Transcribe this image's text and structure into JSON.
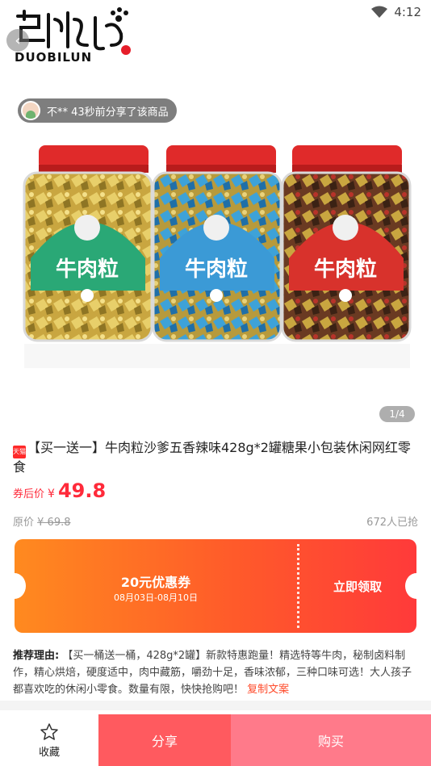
{
  "status_bar": {
    "time": "4:12",
    "wifi_icon": "wifi-icon"
  },
  "brand": {
    "logo_text": "DUOBILUN"
  },
  "share_notice": {
    "text": "不** 43秒前分享了该商品"
  },
  "gallery": {
    "indicator": "1/4",
    "product_label": "牛肉粒"
  },
  "product": {
    "badge": "天猫",
    "title": "【买一送一】牛肉粒沙爹五香辣味428g*2罐糖果小包装休闲网红零食",
    "price_label": "券后价",
    "price_symbol": "¥",
    "price": "49.8",
    "original_label": "原价",
    "original_price": "¥ 69.8",
    "sold_count": "672人已抢"
  },
  "coupon": {
    "amount": "20元优惠券",
    "dates": "08月03日-08月10日",
    "claim_label": "立即领取"
  },
  "recommendation": {
    "label": "推荐理由:",
    "text": "【买一桶送一桶，428g*2罐】新款特惠跑量！精选特等牛肉，秘制卤料制作，精心烘焙，硬度适中，肉中藏筋，嚼劲十足，香味浓郁，三种口味可选！大人孩子都喜欢吃的休闲小零食。数量有限，快快抢购吧！",
    "copy_label": "复制文案"
  },
  "bottom_bar": {
    "favorite_label": "收藏",
    "share_label": "分享",
    "buy_label": "购买"
  },
  "colors": {
    "accent": "#ff2a3a",
    "coupon_start": "#ff8a1f",
    "coupon_end": "#ff3a3a",
    "share_button": "#ff5a5f",
    "buy_button": "#ff7a8a"
  }
}
